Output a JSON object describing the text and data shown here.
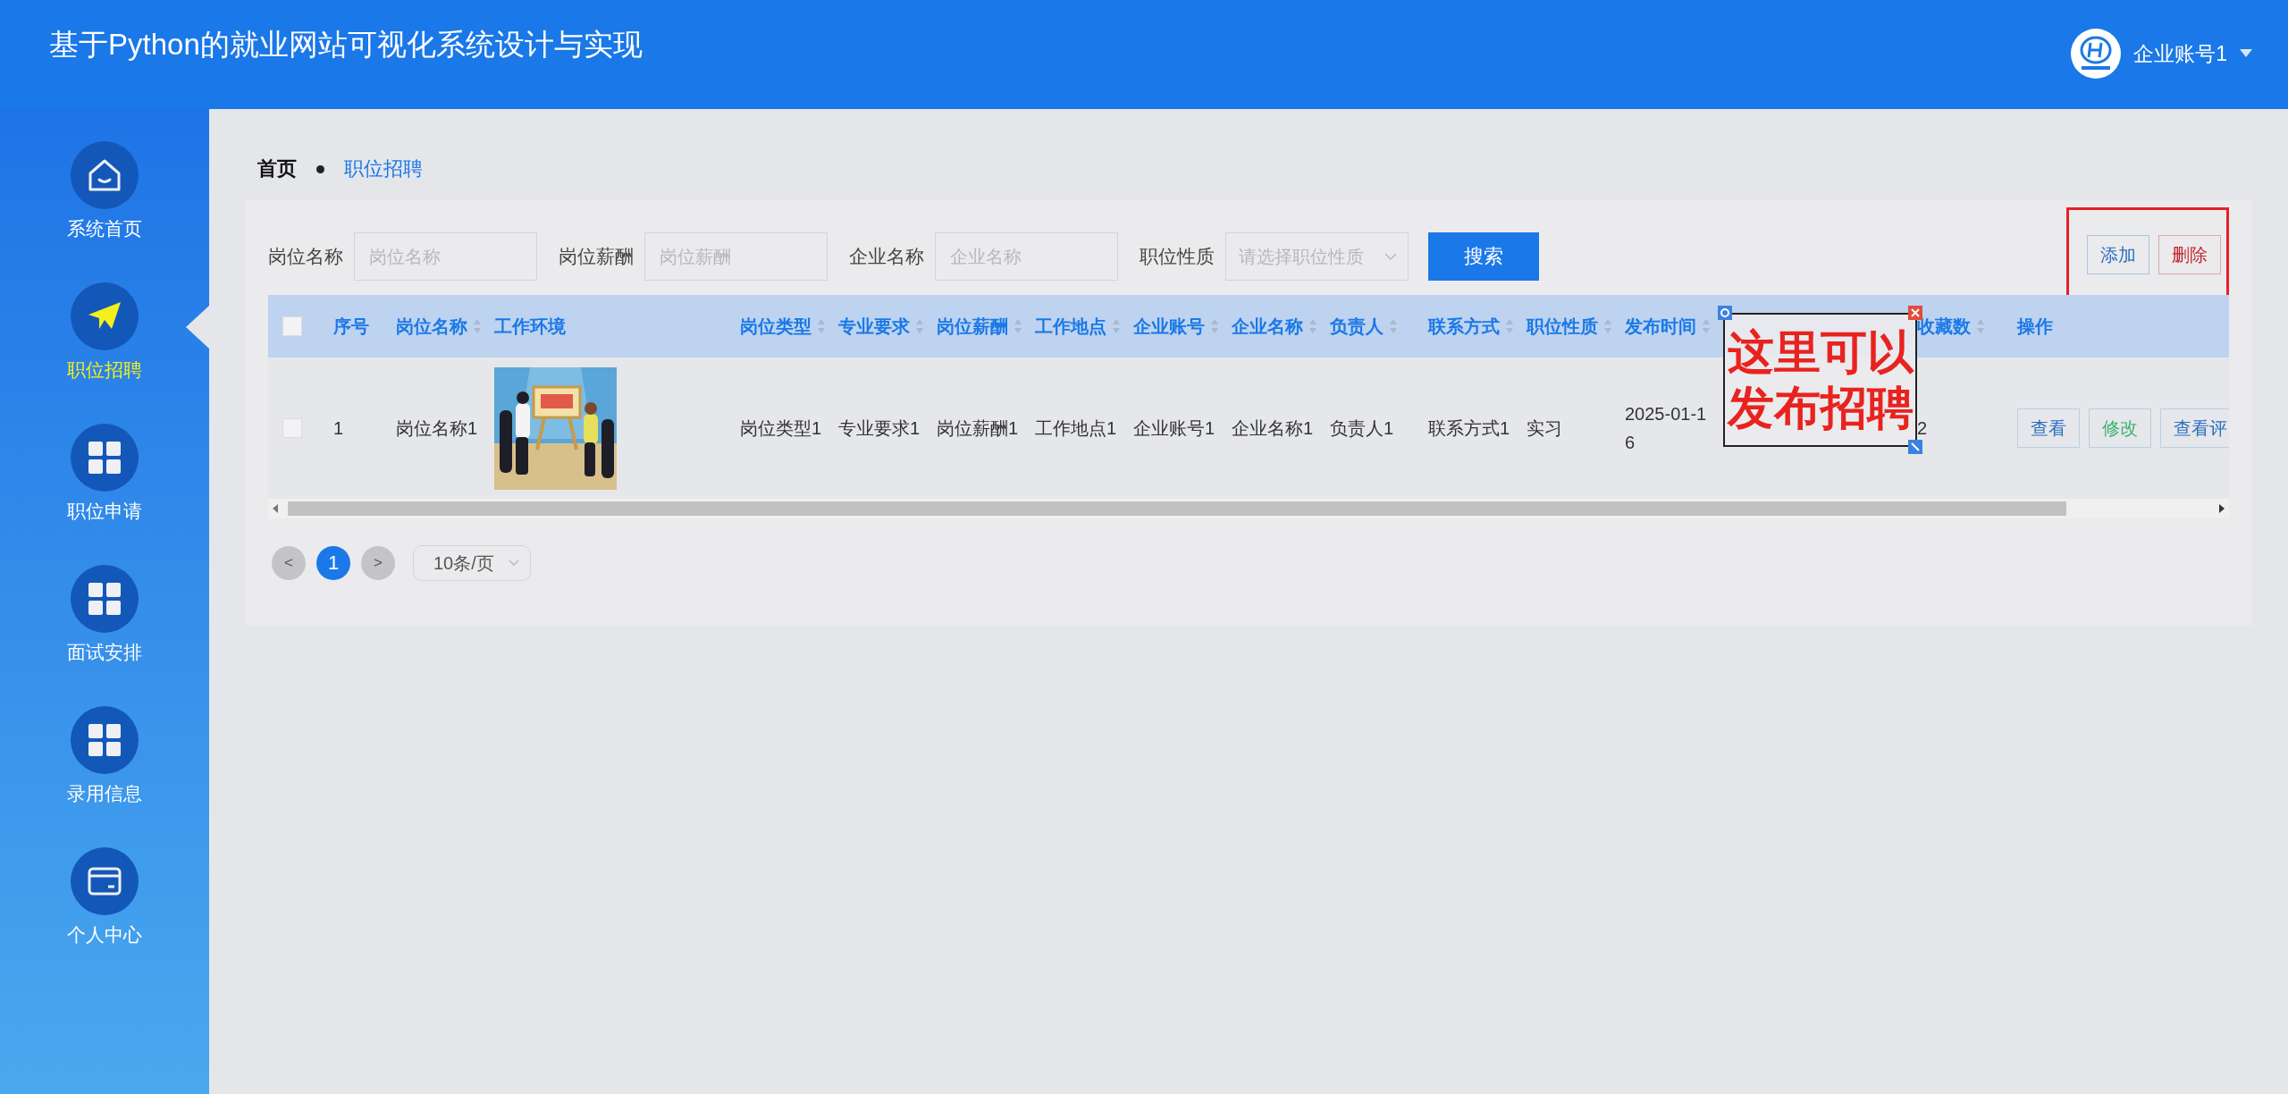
{
  "header": {
    "title": "基于Python的就业网站可视化系统设计与实现",
    "user": "企业账号1"
  },
  "sidebar": {
    "items": [
      {
        "label": "系统首页",
        "kind": "home",
        "selected": false
      },
      {
        "label": "职位招聘",
        "kind": "plane",
        "selected": true
      },
      {
        "label": "职位申请",
        "kind": "grid",
        "selected": false
      },
      {
        "label": "面试安排",
        "kind": "grid",
        "selected": false
      },
      {
        "label": "录用信息",
        "kind": "grid",
        "selected": false
      },
      {
        "label": "个人中心",
        "kind": "card",
        "selected": false
      }
    ]
  },
  "breadcrumb": [
    {
      "label": "首页",
      "selected": false
    },
    {
      "label": "职位招聘",
      "selected": true
    }
  ],
  "search": {
    "fields": [
      {
        "label": "岗位名称",
        "placeholder": "岗位名称",
        "kind": "input"
      },
      {
        "label": "岗位薪酬",
        "placeholder": "岗位薪酬",
        "kind": "input"
      },
      {
        "label": "企业名称",
        "placeholder": "企业名称",
        "kind": "input"
      },
      {
        "label": "职位性质",
        "placeholder": "请选择职位性质",
        "kind": "select"
      }
    ],
    "button": "搜索"
  },
  "actions": {
    "highlighted": true,
    "buttons": [
      {
        "label": "添加",
        "kind": "add"
      },
      {
        "label": "删除",
        "kind": "delete"
      }
    ]
  },
  "table": {
    "all_checked": false,
    "columns": [
      {
        "label": "序号",
        "sortable": false
      },
      {
        "label": "岗位名称",
        "sortable": true
      },
      {
        "label": "工作环境",
        "sortable": false
      },
      {
        "label": "岗位类型",
        "sortable": true
      },
      {
        "label": "专业要求",
        "sortable": true
      },
      {
        "label": "岗位薪酬",
        "sortable": true
      },
      {
        "label": "工作地点",
        "sortable": true
      },
      {
        "label": "企业账号",
        "sortable": true
      },
      {
        "label": "企业名称",
        "sortable": true
      },
      {
        "label": "负责人",
        "sortable": true
      },
      {
        "label": "联系方式",
        "sortable": true
      },
      {
        "label": "职位性质",
        "sortable": true
      },
      {
        "label": "发布时间",
        "sortable": true
      },
      {
        "label": "收藏数",
        "sortable": true
      },
      {
        "label": "操作",
        "sortable": false
      }
    ],
    "rows": [
      {
        "checked": false,
        "cells": [
          {
            "text": "1"
          },
          {
            "text": "岗位名称1"
          },
          {
            "kind": "picture"
          },
          {
            "text": "岗位类型1"
          },
          {
            "text": "专业要求1"
          },
          {
            "text": "岗位薪酬1"
          },
          {
            "text": "工作地点1"
          },
          {
            "text": "企业账号1"
          },
          {
            "text": "企业名称1"
          },
          {
            "text": "负责人1"
          },
          {
            "text": "联系方式1"
          },
          {
            "text": "实习"
          },
          {
            "text": "2025-01-16"
          },
          {
            "text": "2"
          }
        ],
        "operations": [
          {
            "label": "查看",
            "kind": "view"
          },
          {
            "label": "修改",
            "kind": "edit"
          },
          {
            "label": "查看评",
            "kind": "view"
          }
        ]
      }
    ]
  },
  "pagination": {
    "pages": [
      {
        "label": "1",
        "selected": true
      }
    ],
    "prev": "<",
    "next": ">",
    "page_size": "10条/页"
  },
  "annotation": {
    "lines": [
      "这里可以",
      "发布招聘"
    ]
  }
}
